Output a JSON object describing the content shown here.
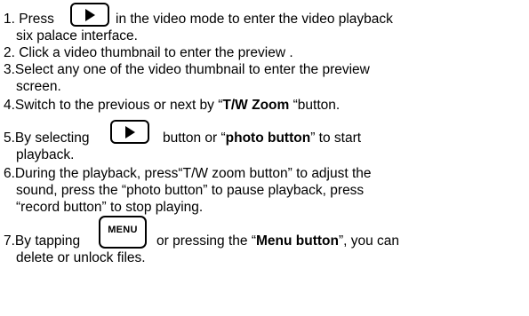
{
  "instructions": {
    "step1": {
      "before_icon": "1. Press",
      "after_icon": "in the video mode to enter the video playback",
      "continuation": "six palace interface."
    },
    "step2": {
      "text": "2. Click a video thumbnail to enter the preview ."
    },
    "step3": {
      "line1": "3.Select any one of the video thumbnail to enter the preview",
      "line2": "screen."
    },
    "step4": {
      "before_bold": "4.Switch to the previous or next by “",
      "bold": "T/W Zoom",
      "after_bold": " “button."
    },
    "step5": {
      "before_icon": "5.By selecting",
      "mid": "button or “",
      "bold": "photo button",
      "after_bold": "” to start",
      "continuation": "playback."
    },
    "step6": {
      "line1": "6.During the playback, press“T/W zoom button” to adjust the",
      "line2": "sound, press the “photo button” to pause playback, press",
      "line3": "“record button” to stop playing."
    },
    "step7": {
      "before_icon": "7.By tapping",
      "mid": "or pressing the “",
      "bold": "Menu button",
      "after_bold": "”, you can",
      "continuation": "delete or unlock files."
    }
  },
  "icons": {
    "play_icon": "play-icon",
    "menu_key_label": "MENU"
  },
  "colors": {
    "text": "#000000",
    "background": "#ffffff"
  }
}
